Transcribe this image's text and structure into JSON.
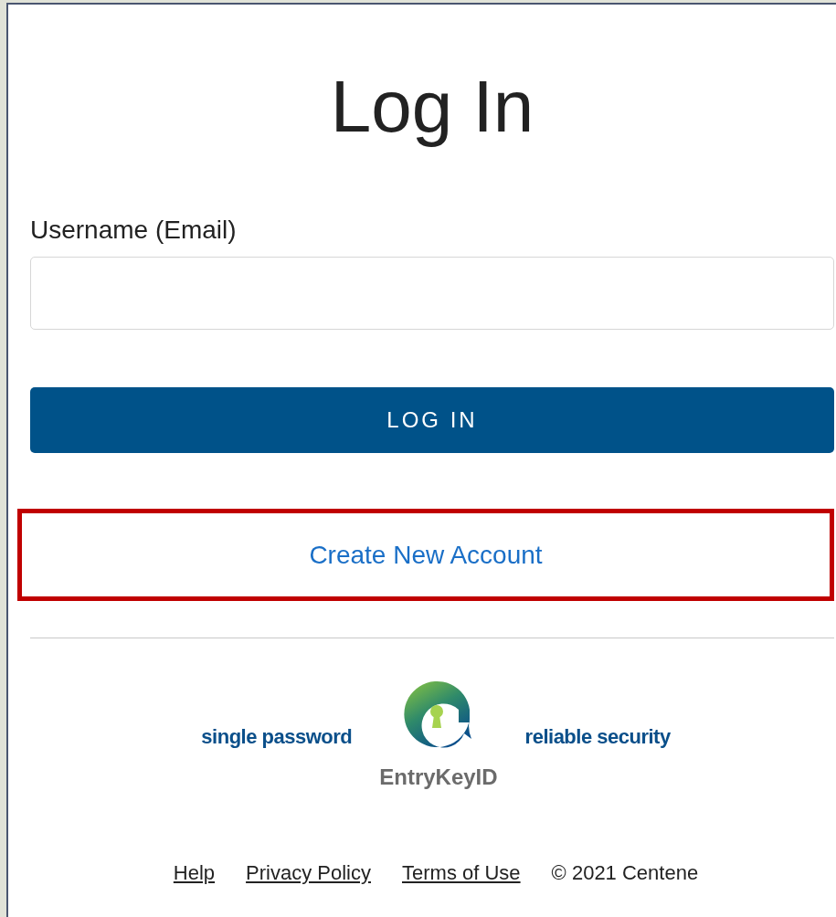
{
  "title": "Log In",
  "username": {
    "label": "Username (Email)"
  },
  "login_button": "LOG IN",
  "create_account": {
    "label": "Create New Account",
    "highlighted": true
  },
  "brand": {
    "tagline_left": "single password",
    "name": "EntryKeyID",
    "tagline_right": "reliable security"
  },
  "footer": {
    "links": [
      "Help ",
      "Privacy Policy",
      "Terms of Use"
    ],
    "copyright": "© 2021 Centene"
  }
}
